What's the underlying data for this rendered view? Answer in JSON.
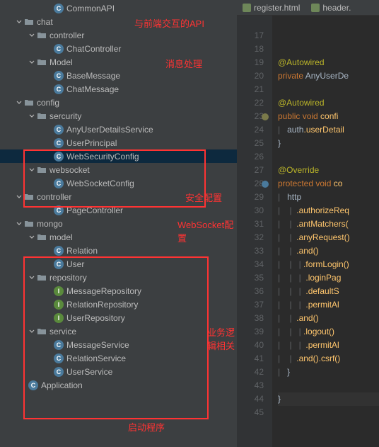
{
  "tabs": [
    {
      "label": "register.html"
    },
    {
      "label": "header."
    }
  ],
  "annotations": {
    "api": "与前端交互的API",
    "msg": "消息处理",
    "sec": "安全配置",
    "ws": "WebSocket配置",
    "biz": "业务逻辑相关",
    "boot": "启动程序"
  },
  "tree": [
    {
      "indent": 4,
      "icon": "c",
      "label": "CommonAPI"
    },
    {
      "indent": 1,
      "expand": "down",
      "folder": true,
      "label": "chat"
    },
    {
      "indent": 2,
      "expand": "down",
      "folder": true,
      "label": "controller"
    },
    {
      "indent": 4,
      "icon": "c",
      "label": "ChatController"
    },
    {
      "indent": 2,
      "expand": "down",
      "folder": true,
      "label": "Model"
    },
    {
      "indent": 4,
      "icon": "c",
      "label": "BaseMessage"
    },
    {
      "indent": 4,
      "icon": "c",
      "label": "ChatMessage"
    },
    {
      "indent": 1,
      "expand": "down",
      "folder": true,
      "label": "config"
    },
    {
      "indent": 2,
      "expand": "down",
      "folder": true,
      "label": "sercurity"
    },
    {
      "indent": 4,
      "icon": "c",
      "label": "AnyUserDetailsService"
    },
    {
      "indent": 4,
      "icon": "c",
      "label": "UserPrincipal"
    },
    {
      "indent": 4,
      "icon": "c",
      "label": "WebSecurityConfig",
      "selected": true
    },
    {
      "indent": 2,
      "expand": "down",
      "folder": true,
      "label": "websocket"
    },
    {
      "indent": 4,
      "icon": "c",
      "label": "WebSocketConfig"
    },
    {
      "indent": 1,
      "expand": "down",
      "folder": true,
      "label": "controller"
    },
    {
      "indent": 4,
      "icon": "c",
      "label": "PageController"
    },
    {
      "indent": 1,
      "expand": "down",
      "folder": true,
      "label": "mongo"
    },
    {
      "indent": 2,
      "expand": "down",
      "folder": true,
      "label": "model"
    },
    {
      "indent": 4,
      "icon": "c",
      "label": "Relation"
    },
    {
      "indent": 4,
      "icon": "c",
      "label": "User"
    },
    {
      "indent": 2,
      "expand": "down",
      "folder": true,
      "label": "repository"
    },
    {
      "indent": 4,
      "icon": "i",
      "label": "MessageRepository"
    },
    {
      "indent": 4,
      "icon": "i",
      "label": "RelationRepository"
    },
    {
      "indent": 4,
      "icon": "i",
      "label": "UserRepository"
    },
    {
      "indent": 2,
      "expand": "down",
      "folder": true,
      "label": "service"
    },
    {
      "indent": 4,
      "icon": "c",
      "label": "MessageService"
    },
    {
      "indent": 4,
      "icon": "c",
      "label": "RelationService"
    },
    {
      "indent": 4,
      "icon": "c",
      "label": "UserService"
    },
    {
      "indent": 2,
      "icon": "c",
      "label": "Application"
    }
  ],
  "gutter": [
    "",
    "17",
    "18",
    "19",
    "20",
    "21",
    "22",
    "23",
    "24",
    "25",
    "26",
    "27",
    "28",
    "29",
    "30",
    "31",
    "32",
    "33",
    "34",
    "35",
    "36",
    "37",
    "38",
    "39",
    "40",
    "41",
    "42",
    "43",
    "44",
    "45"
  ],
  "code": {
    "l19": {
      "anno": "@Autowired"
    },
    "l20": {
      "kw": "private",
      "type": " AnyUserDe"
    },
    "l22": {
      "anno": "@Autowired"
    },
    "l23": {
      "kw1": "public",
      "kw2": " void ",
      "m": "confi"
    },
    "l24": {
      "id": "auth",
      "m": ".userDetail"
    },
    "l27": {
      "anno": "@Override"
    },
    "l28": {
      "kw1": "protected",
      "kw2": " void ",
      "m": "co"
    },
    "l29": {
      "id": "http"
    },
    "l30": {
      "m": ".authorizeReq"
    },
    "l31": {
      "m": ".antMatchers("
    },
    "l32": {
      "m": ".anyRequest()"
    },
    "l33": {
      "m": ".and()"
    },
    "l34": {
      "m": ".formLogin()"
    },
    "l35": {
      "m": ".loginPag"
    },
    "l36": {
      "m": ".defaultS"
    },
    "l37": {
      "m": ".permitAl"
    },
    "l38": {
      "m": ".and()"
    },
    "l39": {
      "m": ".logout()"
    },
    "l40": {
      "m": ".permitAl"
    },
    "l41": {
      "m1": ".and()",
      "m2": ".csrf()"
    }
  }
}
